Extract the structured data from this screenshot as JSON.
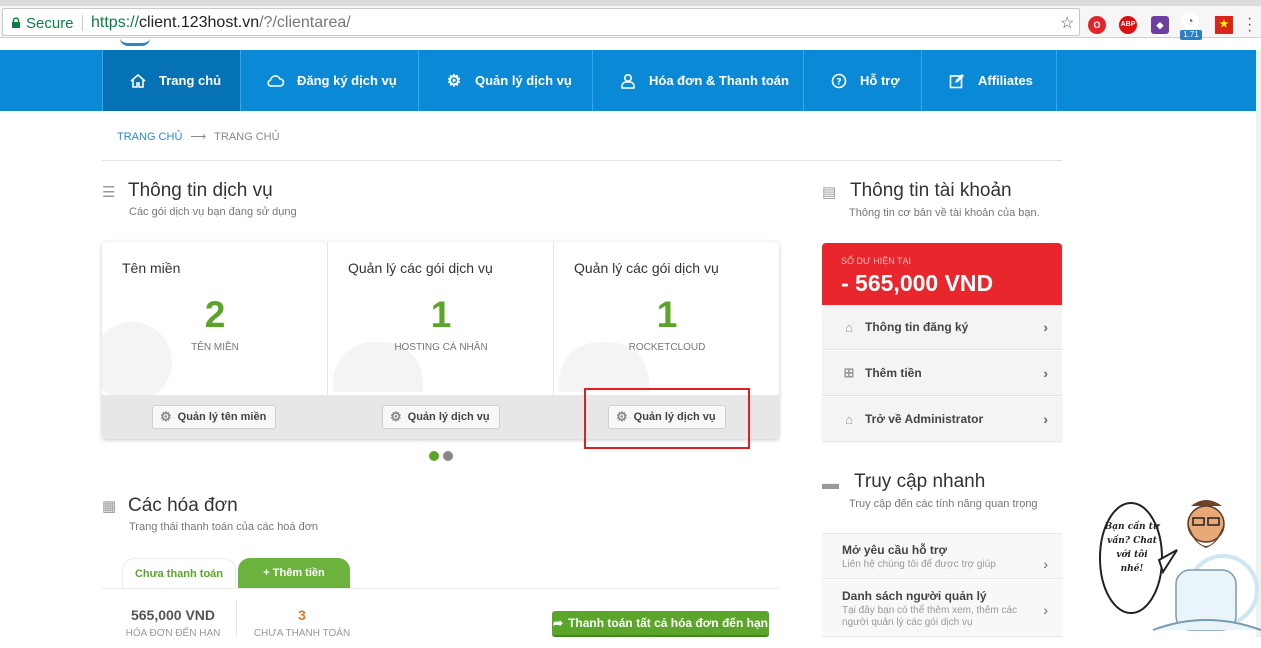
{
  "browser": {
    "secure_label": "Secure",
    "url_scheme": "https://",
    "url_host": "client.123host.vn",
    "url_path": "/?/clientarea/",
    "ext_badge": "1.71"
  },
  "nav": {
    "items": [
      {
        "label": "Trang chủ",
        "icon": "home-icon"
      },
      {
        "label": "Đăng ký dịch vụ",
        "icon": "cloud-icon"
      },
      {
        "label": "Quản lý dịch vụ",
        "icon": "gear-icon"
      },
      {
        "label": "Hóa đơn & Thanh toán",
        "icon": "user-icon"
      },
      {
        "label": "Hỗ trợ",
        "icon": "help-icon"
      },
      {
        "label": "Affiliates",
        "icon": "edit-icon"
      }
    ]
  },
  "breadcrumb": {
    "home": "TRANG CHỦ",
    "current": "TRANG CHỦ"
  },
  "services": {
    "title": "Thông tin dịch vụ",
    "subtitle": "Các gói dịch vụ bạn đang sử dụng",
    "cards": [
      {
        "title": "Tên miền",
        "count": "2",
        "label": "TÊN MIỀN",
        "button": "Quản lý tên miền"
      },
      {
        "title": "Quản lý các gói dịch vụ",
        "count": "1",
        "label": "HOSTING CÁ NHÂN",
        "button": "Quản lý dịch vụ"
      },
      {
        "title": "Quản lý các gói dịch vụ",
        "count": "1",
        "label": "ROCKETCLOUD",
        "button": "Quản lý dịch vụ"
      }
    ]
  },
  "account": {
    "title": "Thông tin tài khoản",
    "subtitle": "Thông tin cơ bản về tài khoản của bạn.",
    "balance_label": "SỐ DƯ HIỆN TẠI",
    "balance_value": "- 565,000 VND",
    "rows": [
      {
        "label": "Thông tin đăng ký",
        "icon": "home-icon"
      },
      {
        "label": "Thêm tiền",
        "icon": "plus-square-icon"
      },
      {
        "label": "Trở về Administrator",
        "icon": "home-icon"
      }
    ]
  },
  "quick_access": {
    "title": "Truy cập nhanh",
    "subtitle": "Truy cập đến các tính năng quan trọng",
    "items": [
      {
        "title": "Mở yêu cầu hỗ trợ",
        "desc": "Liên hệ chúng tôi để được trợ giúp"
      },
      {
        "title": "Danh sách người quản lý",
        "desc": "Tại đây bạn có thể thêm xem, thêm các người quản lý các gói dịch vụ"
      }
    ]
  },
  "invoices": {
    "title": "Các hóa đơn",
    "subtitle": "Trạng thái thanh toán của các hoá đơn",
    "tab_unpaid": "Chưa thanh toán",
    "tab_addfunds": "+ Thêm tiền",
    "stat1_value": "565,000 VND",
    "stat1_label": "HÓA ĐƠN ĐẾN HẠN",
    "stat2_value": "3",
    "stat2_label": "CHƯA THANH TOÁN",
    "pay_all": "Thanh toán tất cả hóa đơn đến hạn"
  },
  "mascot": {
    "bubble": "Bạn cần tư vấn? Chat với tôi nhé!"
  },
  "colors": {
    "nav_blue": "#0a8ad6",
    "green": "#5aa52a",
    "red": "#e8262c"
  }
}
